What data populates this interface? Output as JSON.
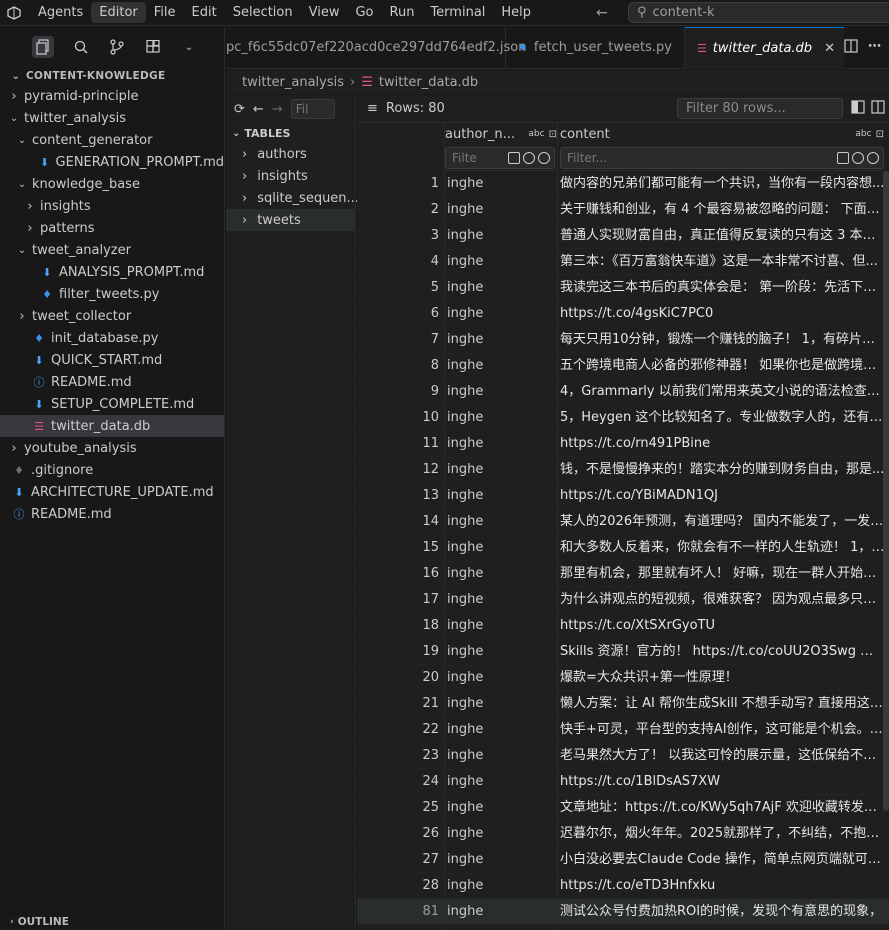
{
  "titlebar": {
    "menus": [
      "Agents",
      "Editor",
      "File",
      "Edit",
      "Selection",
      "View",
      "Go",
      "Run",
      "Terminal",
      "Help"
    ],
    "active_menu": "Editor",
    "search_text": "content-k"
  },
  "sidebar": {
    "section_title": "CONTENT-KNOWLEDGE",
    "tree": [
      {
        "label": "pyramid-principle",
        "depth": 0,
        "kind": "folder",
        "open": false
      },
      {
        "label": "twitter_analysis",
        "depth": 0,
        "kind": "folder",
        "open": true
      },
      {
        "label": "content_generator",
        "depth": 1,
        "kind": "folder",
        "open": true
      },
      {
        "label": "GENERATION_PROMPT.md",
        "depth": 2,
        "kind": "md"
      },
      {
        "label": "knowledge_base",
        "depth": 1,
        "kind": "folder",
        "open": true
      },
      {
        "label": "insights",
        "depth": 2,
        "kind": "folder",
        "open": false
      },
      {
        "label": "patterns",
        "depth": 2,
        "kind": "folder",
        "open": false
      },
      {
        "label": "tweet_analyzer",
        "depth": 1,
        "kind": "folder",
        "open": true
      },
      {
        "label": "ANALYSIS_PROMPT.md",
        "depth": 2,
        "kind": "md"
      },
      {
        "label": "filter_tweets.py",
        "depth": 2,
        "kind": "py"
      },
      {
        "label": "tweet_collector",
        "depth": 1,
        "kind": "folder",
        "open": false
      },
      {
        "label": "init_database.py",
        "depth": 1,
        "kind": "py"
      },
      {
        "label": "QUICK_START.md",
        "depth": 1,
        "kind": "md"
      },
      {
        "label": "README.md",
        "depth": 1,
        "kind": "info"
      },
      {
        "label": "SETUP_COMPLETE.md",
        "depth": 1,
        "kind": "md"
      },
      {
        "label": "twitter_data.db",
        "depth": 1,
        "kind": "db",
        "selected": true
      },
      {
        "label": "youtube_analysis",
        "depth": 0,
        "kind": "folder",
        "open": false
      },
      {
        "label": ".gitignore",
        "depth": 0,
        "kind": "git"
      },
      {
        "label": "ARCHITECTURE_UPDATE.md",
        "depth": 0,
        "kind": "md"
      },
      {
        "label": "README.md",
        "depth": 0,
        "kind": "info"
      }
    ],
    "outline_title": "OUTLINE"
  },
  "tabs": [
    {
      "label": "pc_f6c55dc07ef220acd0ce297dd764edf2.json",
      "icon": "json",
      "active": false
    },
    {
      "label": "fetch_user_tweets.py",
      "icon": "py",
      "active": false
    },
    {
      "label": "twitter_data.db",
      "icon": "db",
      "active": true
    }
  ],
  "breadcrumb": [
    "twitter_analysis",
    "twitter_data.db"
  ],
  "db": {
    "filter_placeholder": "Fil",
    "tables_title": "TABLES",
    "tables": [
      "authors",
      "insights",
      "sqlite_sequen...",
      "tweets"
    ],
    "selected_table": "tweets"
  },
  "grid": {
    "rows_label": "Rows: 80",
    "rows_filter_placeholder": "Filter 80 rows...",
    "columns": [
      {
        "name": "author_n...",
        "type": "abc",
        "filter_placeholder": "Filte"
      },
      {
        "name": "content",
        "type": "abc",
        "filter_placeholder": "Filter..."
      }
    ],
    "rows": [
      {
        "idx": "1",
        "author": "inghe",
        "content": "做内容的兄弟们都可能有一个共识，当你有一段内容想..."
      },
      {
        "idx": "2",
        "author": "inghe",
        "content": "关于赚钱和创业，有 4 个最容易被忽略的问题： 下面的..."
      },
      {
        "idx": "3",
        "author": "inghe",
        "content": "普通人实现财富自由，真正值得反复读的只有这 3 本书，..."
      },
      {
        "idx": "4",
        "author": "inghe",
        "content": "第三本：《百万富翁快车道》这是一本非常不讨喜、但..."
      },
      {
        "idx": "5",
        "author": "inghe",
        "content": "我读完这三本书后的真实体会是： 第一阶段：先活下来..."
      },
      {
        "idx": "6",
        "author": "inghe",
        "content": "https://t.co/4gsKiC7PC0"
      },
      {
        "idx": "7",
        "author": "inghe",
        "content": "每天只用10分钟，锻炼一个赚钱的脑子！ 1，有碎片想..."
      },
      {
        "idx": "8",
        "author": "inghe",
        "content": "五个跨境电商人必备的邪修神器！ 如果你也是做跨境的..."
      },
      {
        "idx": "9",
        "author": "inghe",
        "content": "4，Grammarly 以前我们常用来英文小说的语法检查，但..."
      },
      {
        "idx": "10",
        "author": "inghe",
        "content": "5，Heygen 这个比较知名了。专业做数字人的，还有一..."
      },
      {
        "idx": "11",
        "author": "inghe",
        "content": "https://t.co/rn491PBine"
      },
      {
        "idx": "12",
        "author": "inghe",
        "content": "钱，不是慢慢挣来的！踏实本分的赚到财务自由，那是..."
      },
      {
        "idx": "13",
        "author": "inghe",
        "content": "https://t.co/YBiMADN1QJ"
      },
      {
        "idx": "14",
        "author": "inghe",
        "content": "某人的2026年预测，有道理吗？ 国内不能发了，一发就..."
      },
      {
        "idx": "15",
        "author": "inghe",
        "content": "和大多数人反着来，你就会有不一样的人生轨迹！ 1，反..."
      },
      {
        "idx": "16",
        "author": "inghe",
        "content": "那里有机会，那里就有坏人！ 好嘛，现在一群人开始教..."
      },
      {
        "idx": "17",
        "author": "inghe",
        "content": "为什么讲观点的短视频，很难获客？ 因为观点最多只能..."
      },
      {
        "idx": "18",
        "author": "inghe",
        "content": "https://t.co/XtSXrGyoTU"
      },
      {
        "idx": "19",
        "author": "inghe",
        "content": "Skills 资源！官方的！ https://t.co/coUU2O3Swg 赶快收..."
      },
      {
        "idx": "20",
        "author": "inghe",
        "content": "爆款=大众共识+第一性原理！"
      },
      {
        "idx": "21",
        "author": "inghe",
        "content": "懒人方案：让 AI 帮你生成Skill 不想手动写? 直接用这个..."
      },
      {
        "idx": "22",
        "author": "inghe",
        "content": "快手+可灵，平台型的支持AI创作，这可能是个机会。 ..."
      },
      {
        "idx": "23",
        "author": "inghe",
        "content": "老马果然大方了！ 以我这可怜的展示量，这低保给不少..."
      },
      {
        "idx": "24",
        "author": "inghe",
        "content": "https://t.co/1BlDsAS7XW"
      },
      {
        "idx": "25",
        "author": "inghe",
        "content": "文章地址：https://t.co/KWy5qh7AjF 欢迎收藏转发！我..."
      },
      {
        "idx": "26",
        "author": "inghe",
        "content": "迟暮尔尔，烟火年年。2025就那样了，不纠结，不抱怨..."
      },
      {
        "idx": "27",
        "author": "inghe",
        "content": "小白没必要去Claude Code 操作，简单点网页端就可以..."
      },
      {
        "idx": "28",
        "author": "inghe",
        "content": "https://t.co/eTD3Hnfxku"
      },
      {
        "idx": "81",
        "author": "inghe",
        "content": "测试公众号付费加热ROI的时候，发现个有意思的现象，"
      }
    ]
  },
  "colors": {
    "accent": "#0078d4",
    "db_icon": "#e25a76",
    "py_icon": "#3b8eea",
    "md_icon": "#4aa3ff"
  }
}
